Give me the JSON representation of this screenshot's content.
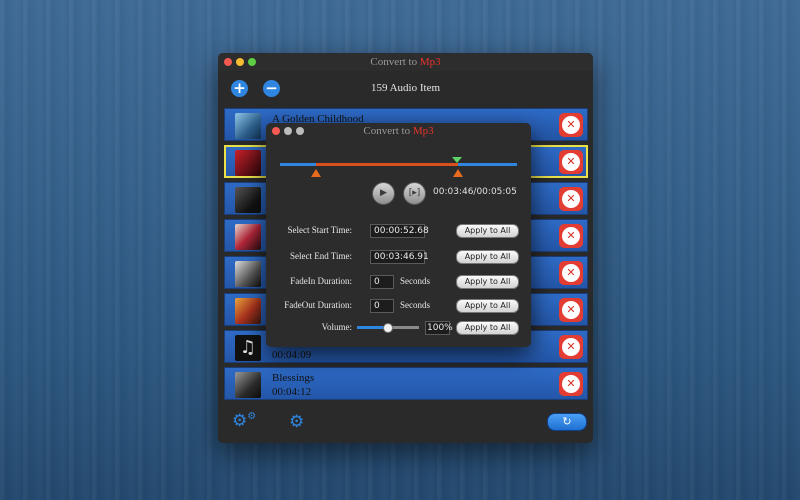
{
  "window": {
    "title_prefix": "Convert to ",
    "title_accent": "Mp3",
    "add_icon": "plus-circle-icon",
    "remove_icon": "minus-circle-icon",
    "item_count": "159 Audio Item"
  },
  "list": {
    "items": [
      {
        "title": "A Golden Childhood",
        "duration": ""
      },
      {
        "title": "",
        "duration": ""
      },
      {
        "title": "",
        "duration": ""
      },
      {
        "title": "",
        "duration": ""
      },
      {
        "title": "",
        "duration": ""
      },
      {
        "title": "",
        "duration": ""
      },
      {
        "title": "",
        "duration": "00:04:09"
      },
      {
        "title": "Blessings",
        "duration": "00:04:12"
      }
    ]
  },
  "bottom": {
    "convert_icon": "refresh-icon"
  },
  "dialog": {
    "title_prefix": "Convert to ",
    "title_accent": "Mp3",
    "time": "00:03:46/00:05:05",
    "start_label": "Select Start Time:",
    "start_value": "00:00:52.68",
    "end_label": "Select End Time:",
    "end_value": "00:03:46.91",
    "fadein_label": "FadeIn Duration:",
    "fadein_value": "0",
    "fadeout_label": "FadeOut Duration:",
    "fadeout_value": "0",
    "seconds_label": "Seconds",
    "volume_label": "Volume:",
    "volume_value": "100%",
    "volume_level": 0.5,
    "apply_label": "Apply to All"
  },
  "colors": {
    "accent_blue": "#2f86e0",
    "accent_red": "#e8332b",
    "selection_yellow": "#e9e04a",
    "trim_orange": "#d9501c",
    "playhead_green": "#5fd26a"
  }
}
